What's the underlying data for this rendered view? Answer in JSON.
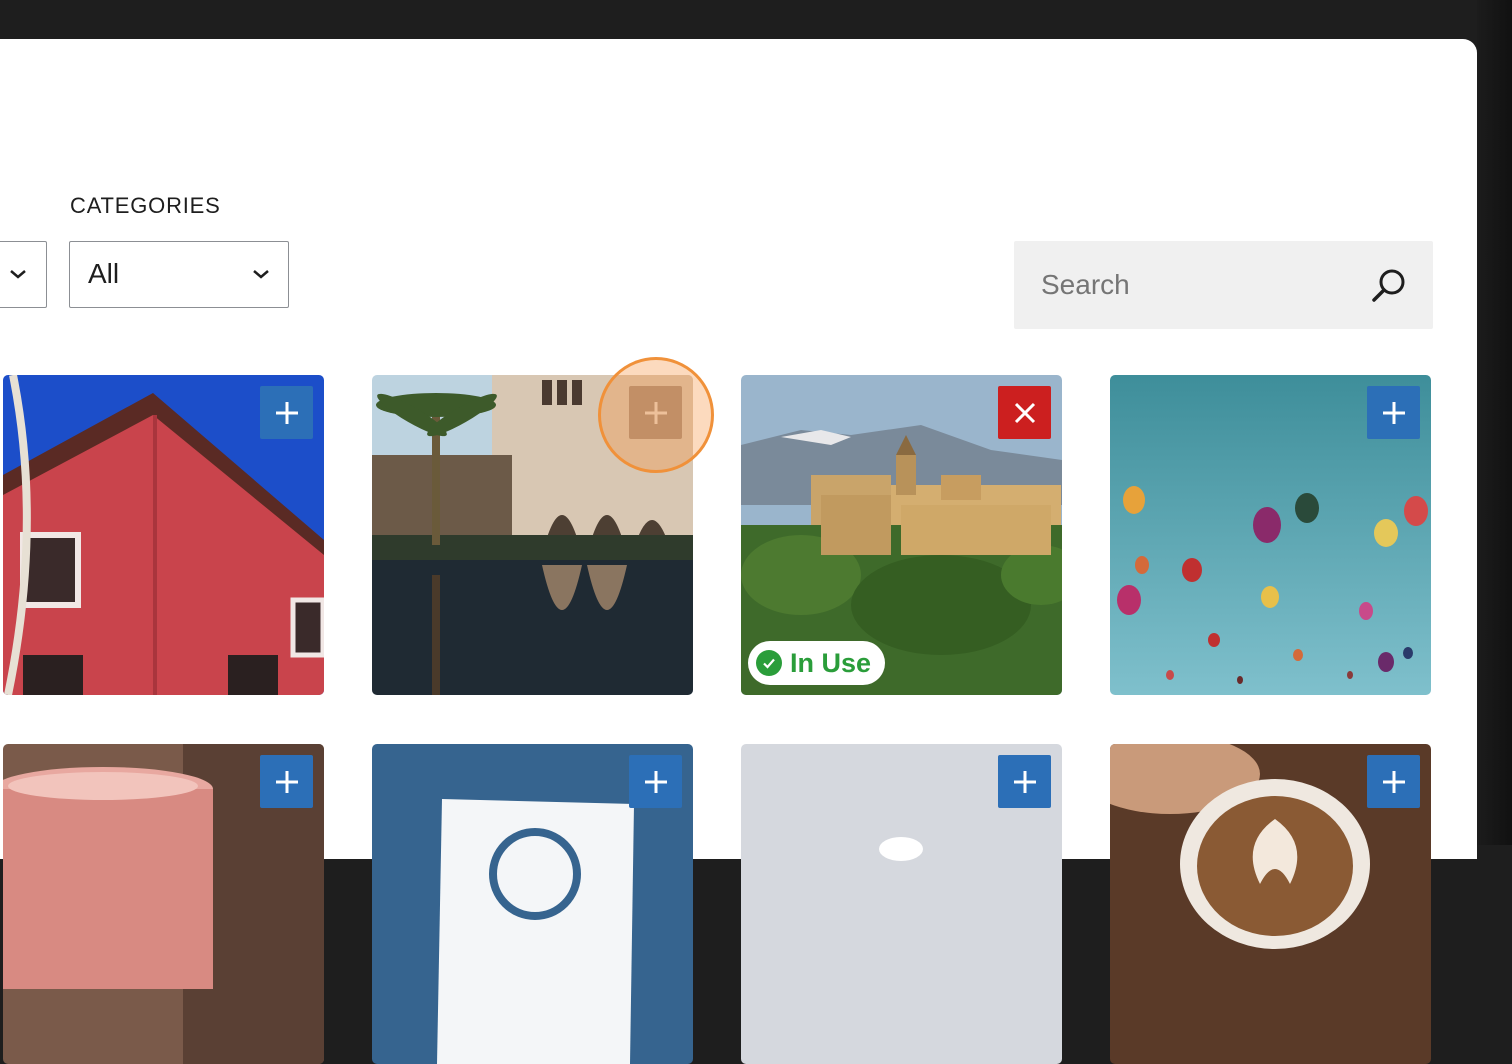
{
  "filters": {
    "categories_label": "CATEGORIES",
    "categories_value": "All"
  },
  "search": {
    "placeholder": "Search",
    "value": ""
  },
  "images": [
    {
      "subject": "red house roof against blue sky",
      "action": "add"
    },
    {
      "subject": "palace courtyard with palm tree and reflecting pool",
      "action": "add",
      "hovered": true
    },
    {
      "subject": "hilltop fortress with mountains",
      "action": "remove",
      "badge": "In Use"
    },
    {
      "subject": "hot air balloons in blue sky",
      "action": "add"
    },
    {
      "subject": "pink coffee mug",
      "action": "add"
    },
    {
      "subject": "blue card with logo",
      "action": "add"
    },
    {
      "subject": "grey placeholder",
      "action": "add"
    },
    {
      "subject": "latte art coffee cup",
      "action": "add"
    }
  ],
  "colors": {
    "add_button": "#2c6fb7",
    "remove_button": "#cc1f1f",
    "in_use": "#2a9d3a",
    "highlight": "#f0913a"
  },
  "icons": {
    "add": "plus-icon",
    "remove": "close-icon",
    "search": "search-icon",
    "select": "chevron-down-icon",
    "badge": "check-icon"
  }
}
